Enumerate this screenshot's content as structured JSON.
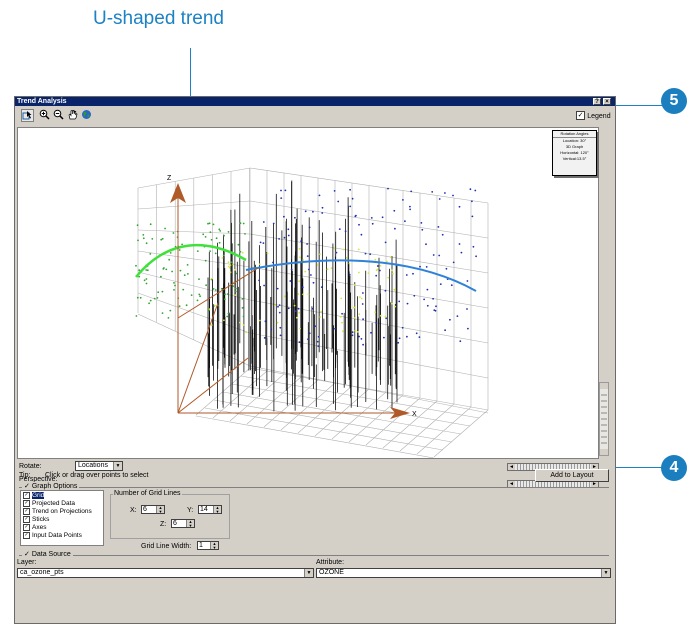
{
  "callouts": {
    "title": "U-shaped trend",
    "step5": "5",
    "step4": "4"
  },
  "window": {
    "title": "Trend Analysis",
    "help_btn": "?",
    "close_btn": "×"
  },
  "toolbar": {
    "tools": [
      "select-icon",
      "zoom-in-icon",
      "zoom-out-icon",
      "pan-hand-icon",
      "globe-icon"
    ],
    "legend_label": "Legend",
    "legend_checked": true
  },
  "graph": {
    "rotation_box": {
      "title": "Rotation Angles",
      "location": "Location: 30°",
      "graph3d": "3D Graph",
      "horizontal": "Horizontal: 120°",
      "vertical": "Vertical:13.5°"
    },
    "axis_z": "Z",
    "axis_x": "X",
    "colors": {
      "green_trend": "#3ee23a",
      "blue_trend": "#2f82d8",
      "axis": "#b05a2a",
      "grid": "#b0b0b0"
    }
  },
  "controls": {
    "rotate_label": "Rotate:",
    "rotate_value": "Locations",
    "perspective_label": "Perspective:",
    "tip_label": "Tip:",
    "tip_text": "Click or drag over points to select",
    "add_to_layout": "Add to Layout"
  },
  "graph_options": {
    "section_label": "Graph Options",
    "items": [
      {
        "label": "Grid",
        "checked": true,
        "selected": true
      },
      {
        "label": "Projected Data",
        "checked": true,
        "selected": false
      },
      {
        "label": "Trend on Projections",
        "checked": true,
        "selected": false
      },
      {
        "label": "Sticks",
        "checked": true,
        "selected": false
      },
      {
        "label": "Axes",
        "checked": true,
        "selected": false
      },
      {
        "label": "Input Data Points",
        "checked": true,
        "selected": false
      }
    ],
    "grid_lines_title": "Number of Grid Lines",
    "x_label": "X:",
    "x_value": "6",
    "y_label": "Y:",
    "y_value": "14",
    "z_label": "Z:",
    "z_value": "6",
    "grid_width_label": "Grid Line Width:",
    "grid_width_value": "1"
  },
  "data_source": {
    "section_label": "Data Source",
    "layer_label": "Layer:",
    "layer_value": "ca_ozone_pts",
    "attribute_label": "Attribute:",
    "attribute_value": "OZONE"
  }
}
